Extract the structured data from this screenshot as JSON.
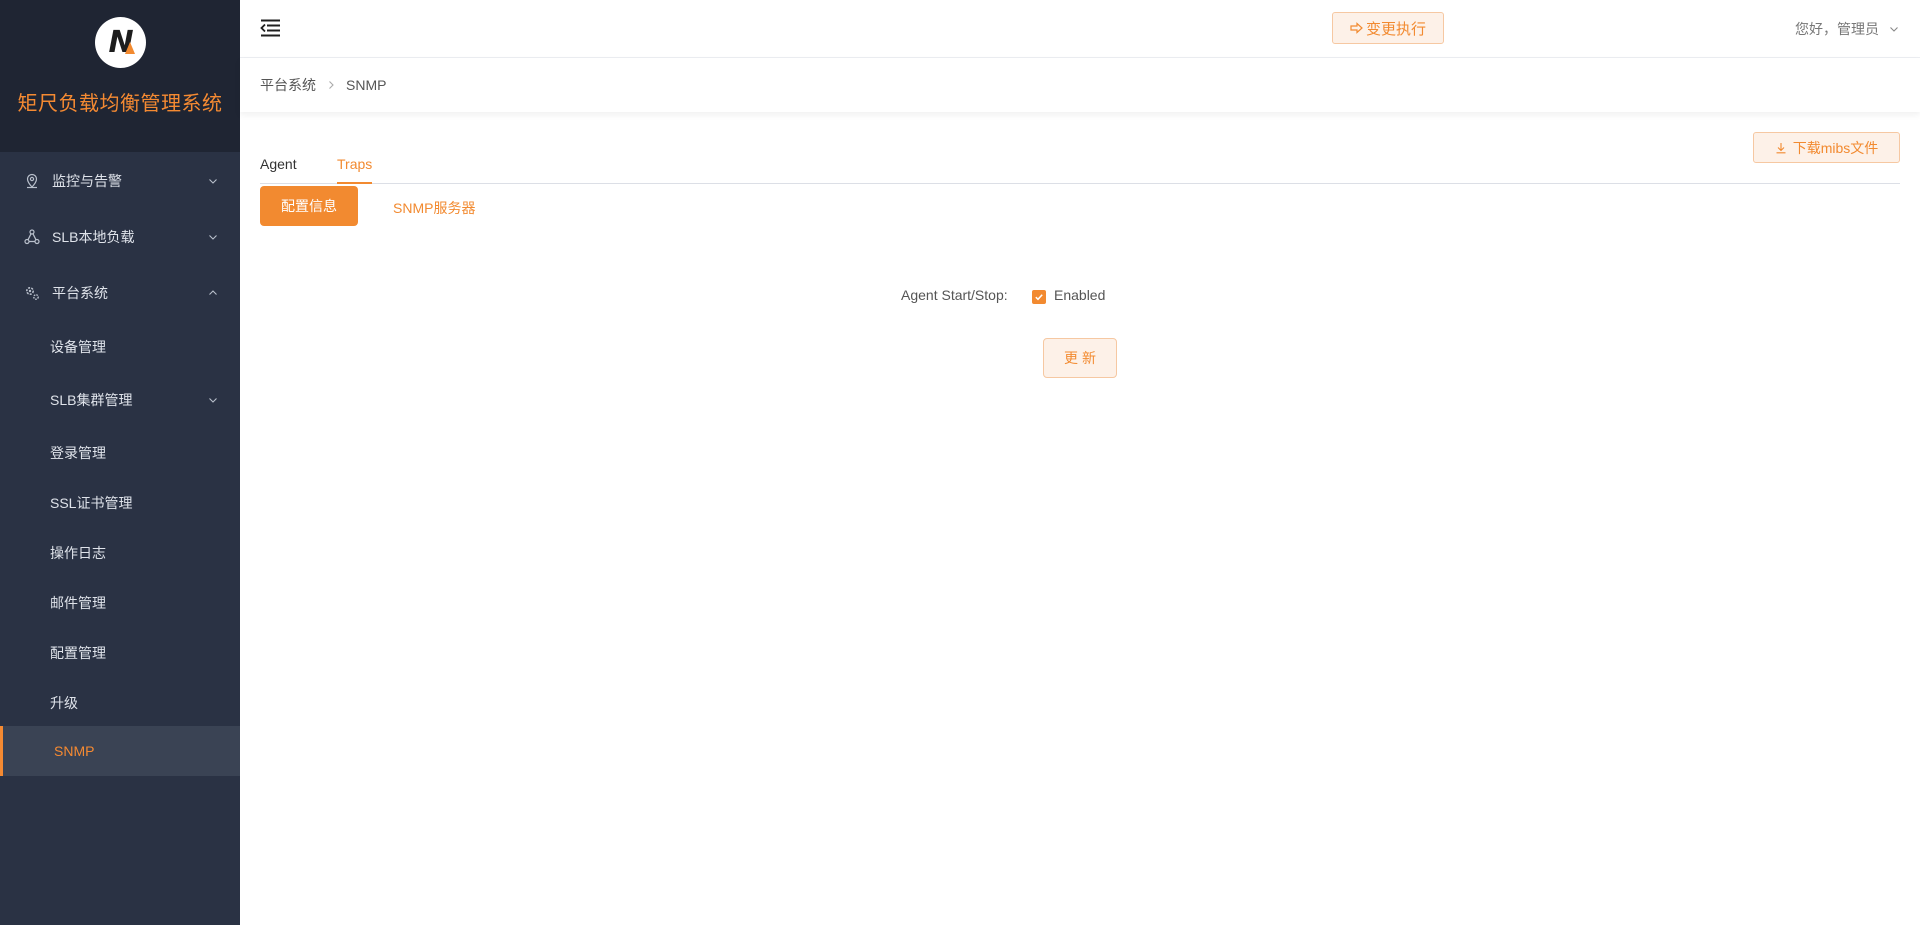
{
  "brand": {
    "title": "矩尺负载均衡管理系统",
    "logo_letter": "N"
  },
  "sidebar": {
    "menus": [
      {
        "label": "监控与告警",
        "icon": "location-pin-icon",
        "expanded": false
      },
      {
        "label": "SLB本地负载",
        "icon": "network-nodes-icon",
        "expanded": false
      },
      {
        "label": "平台系统",
        "icon": "gears-icon",
        "expanded": true
      }
    ],
    "sub_items": [
      {
        "label": "设备管理"
      },
      {
        "label": "SLB集群管理",
        "has_children": true
      },
      {
        "label": "登录管理"
      },
      {
        "label": "SSL证书管理"
      },
      {
        "label": "操作日志"
      },
      {
        "label": "邮件管理"
      },
      {
        "label": "配置管理"
      },
      {
        "label": "升级"
      },
      {
        "label": "SNMP",
        "active": true
      }
    ]
  },
  "header": {
    "exec_button": "变更执行",
    "user_greeting": "您好，管理员"
  },
  "breadcrumb": [
    "平台系统",
    "SNMP"
  ],
  "tabs": [
    {
      "label": "Agent",
      "active": false
    },
    {
      "label": "Traps",
      "active": true
    }
  ],
  "download_button": "下载mibs文件",
  "subtabs": {
    "primary": "配置信息",
    "secondary": "SNMP服务器"
  },
  "form": {
    "agent_label": "Agent Start/Stop:",
    "enabled_label": "Enabled",
    "enabled_checked": true,
    "update_button": "更新"
  },
  "colors": {
    "accent": "#f28a30",
    "sidebar_bg": "#2a3244",
    "brand_bg": "#1f2533"
  }
}
